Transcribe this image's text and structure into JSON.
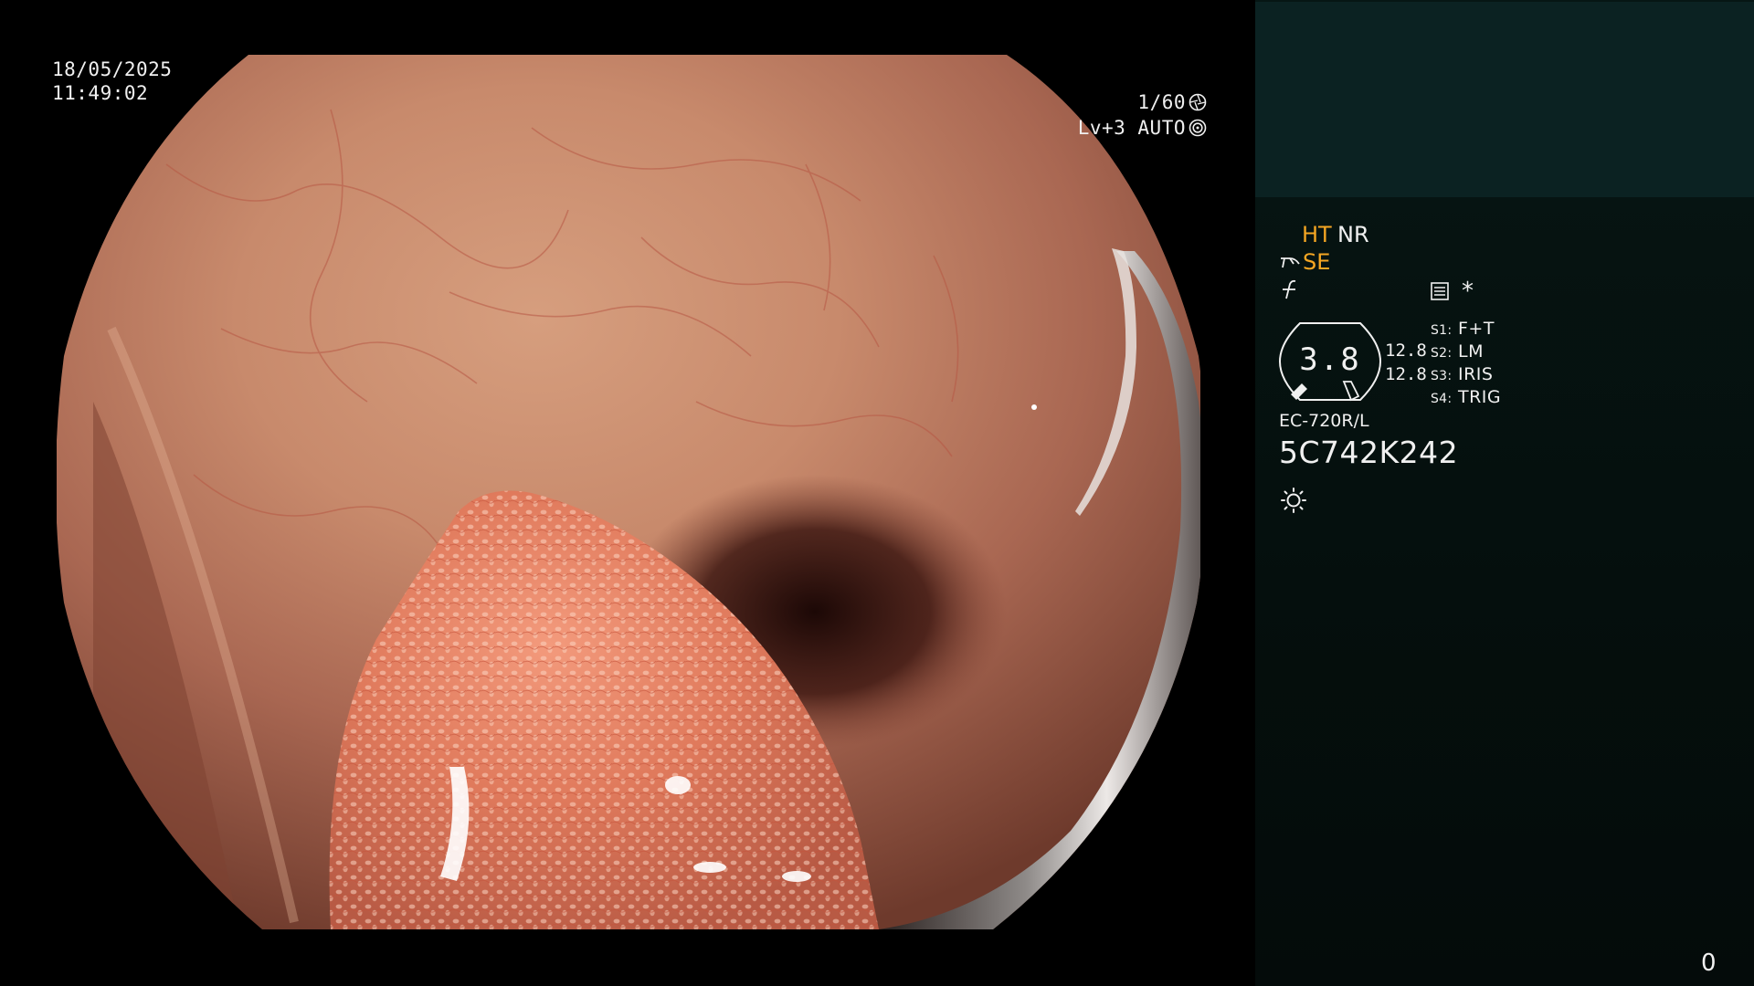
{
  "osd": {
    "date": "18/05/2025",
    "time": "11:49:02",
    "shutter": "1/60",
    "level": "Lv+3 AUTO"
  },
  "panel": {
    "mode_ht": "HT",
    "mode_nr": "NR",
    "mode_se": "SE",
    "asterisk": "*",
    "zoom": "3.8",
    "gain_1": "12.8",
    "gain_2": "12.8",
    "switches": [
      {
        "key": "S1:",
        "value": "F+T"
      },
      {
        "key": "S2:",
        "value": "LM"
      },
      {
        "key": "S3:",
        "value": "IRIS"
      },
      {
        "key": "S4:",
        "value": "TRIG"
      }
    ],
    "scope_model": "EC-720R/L",
    "scope_serial": "5C742K242",
    "counter": "0"
  },
  "colors": {
    "panel_bg": "#061614",
    "patient_block_bg": "#0b2222",
    "accent_orange": "#f5a623",
    "osd_text": "#f0f0f0"
  },
  "icons": {
    "shutter": "aperture-icon",
    "auto_iris": "iris-icon",
    "structure_enhance": "scope-tip-icon",
    "filter": "filter-icon",
    "panel": "settings-panel-icon",
    "light": "sun-light-icon"
  }
}
